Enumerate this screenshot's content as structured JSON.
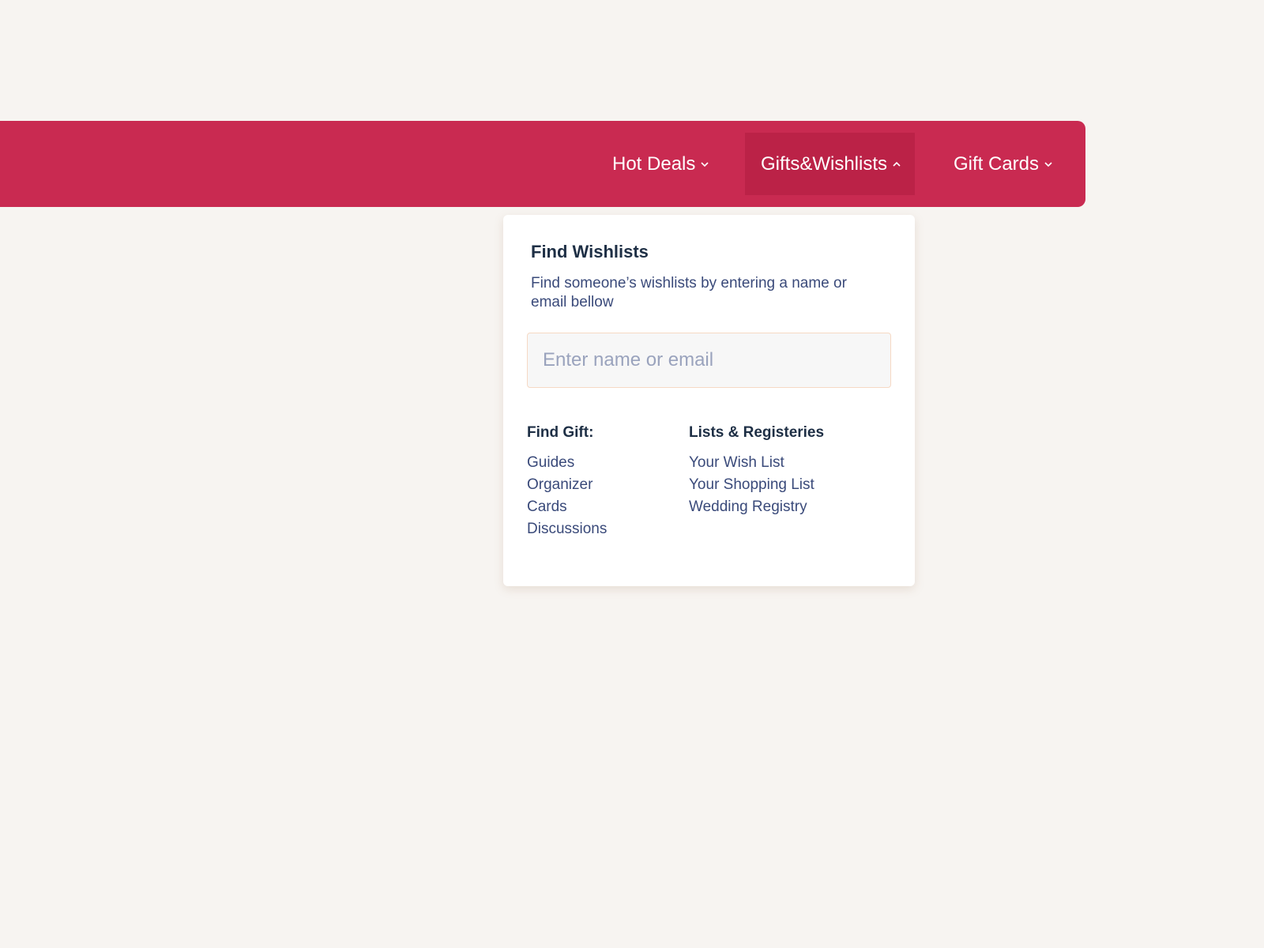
{
  "navbar": {
    "items": [
      {
        "label": "Hot Deals",
        "icon": "chevron-down-icon"
      },
      {
        "label": "Gifts&Wishlists",
        "icon": "chevron-up-icon",
        "active": true
      },
      {
        "label": "Gift Cards",
        "icon": "chevron-down-icon"
      }
    ]
  },
  "dropdown": {
    "title": "Find Wishlists",
    "description": "Find someone’s wishlists by entering a name or email bellow",
    "search": {
      "placeholder": "Enter name or email",
      "value": ""
    },
    "find_gift": {
      "heading": "Find Gift:",
      "links": [
        "Guides",
        "Organizer",
        "Cards",
        "Discussions"
      ]
    },
    "lists": {
      "heading": "Lists & Registeries",
      "links": [
        "Your Wish List",
        "Your Shopping List",
        "Wedding Registry"
      ]
    }
  },
  "colors": {
    "background": "#f7f4f1",
    "navbar": "#c92a51",
    "nav_active": "#bb2247",
    "heading_text": "#1e2f45",
    "link_text": "#3a4a7a",
    "input_border": "#f6d9c4",
    "placeholder": "#9aa3bd"
  }
}
